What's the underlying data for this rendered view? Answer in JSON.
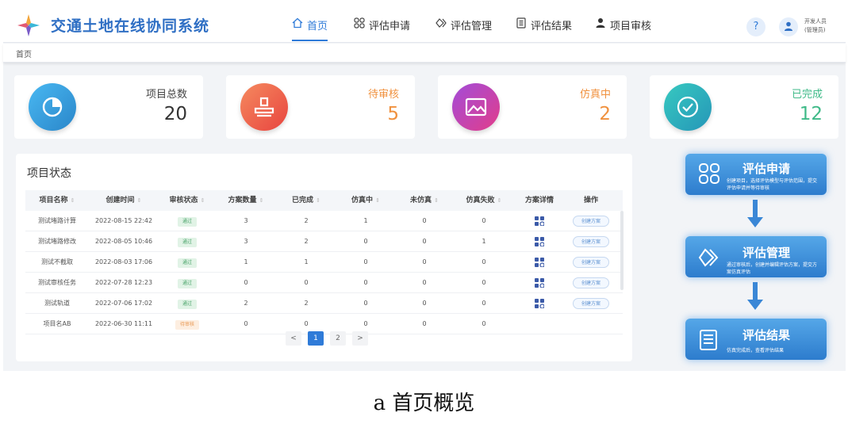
{
  "header": {
    "title": "交通土地在线协同系统",
    "nav": [
      {
        "label": "首页",
        "icon": "home-icon"
      },
      {
        "label": "评估申请",
        "icon": "grid-icon"
      },
      {
        "label": "评估管理",
        "icon": "diamond-icon"
      },
      {
        "label": "评估结果",
        "icon": "document-icon"
      },
      {
        "label": "项目审核",
        "icon": "user-icon"
      }
    ],
    "help_icon": "?",
    "user_name": "开发人员",
    "user_role": "(管理员)"
  },
  "breadcrumb": "首页",
  "stats": [
    {
      "label": "项目总数",
      "value": "20",
      "color": "#333333",
      "icon": "pie-chart-icon"
    },
    {
      "label": "待审核",
      "value": "5",
      "color": "#f0913e",
      "icon": "stamp-icon"
    },
    {
      "label": "仿真中",
      "value": "2",
      "color": "#f0913e",
      "icon": "image-icon"
    },
    {
      "label": "已完成",
      "value": "12",
      "color": "#3fba88",
      "icon": "check-circle-icon"
    }
  ],
  "status_panel": {
    "title": "项目状态",
    "columns": [
      "项目名称",
      "创建时间",
      "审核状态",
      "方案数量",
      "已完成",
      "仿真中",
      "未仿真",
      "仿真失败",
      "方案详情",
      "操作"
    ],
    "sort_icon": "⇕",
    "rows": [
      {
        "name": "测试堵路计算",
        "time": "2022-08-15 22:42",
        "status": "通过",
        "plans": "3",
        "done": "2",
        "running": "1",
        "notrun": "0",
        "failed": "0",
        "action": "创建方案"
      },
      {
        "name": "测试堵路修改",
        "time": "2022-08-05 10:46",
        "status": "通过",
        "plans": "3",
        "done": "2",
        "running": "0",
        "notrun": "0",
        "failed": "1",
        "action": "创建方案"
      },
      {
        "name": "测试不截取",
        "time": "2022-08-03 17:06",
        "status": "通过",
        "plans": "1",
        "done": "1",
        "running": "0",
        "notrun": "0",
        "failed": "0",
        "action": "创建方案"
      },
      {
        "name": "测试审核任务",
        "time": "2022-07-28 12:23",
        "status": "通过",
        "plans": "0",
        "done": "0",
        "running": "0",
        "notrun": "0",
        "failed": "0",
        "action": "创建方案"
      },
      {
        "name": "测试轨道",
        "time": "2022-07-06 17:02",
        "status": "通过",
        "plans": "2",
        "done": "2",
        "running": "0",
        "notrun": "0",
        "failed": "0",
        "action": "创建方案"
      },
      {
        "name": "项目名AB",
        "time": "2022-06-30 11:11",
        "status": "待审核",
        "plans": "0",
        "done": "0",
        "running": "0",
        "notrun": "0",
        "failed": "0",
        "action": ""
      }
    ],
    "pagination": {
      "prev": "<",
      "pages": [
        "1",
        "2"
      ],
      "current": "1",
      "next": ">"
    }
  },
  "flow": [
    {
      "title": "评估申请",
      "desc": "创建项目，选择评估模型与评估范围，提交评估申请并等待审核",
      "icon": "grid-icon"
    },
    {
      "title": "评估管理",
      "desc": "通过审核后，创建并编辑评估方案，提交方案仿真评估",
      "icon": "diamond-icon"
    },
    {
      "title": "评估结果",
      "desc": "仿真完成后，查看评估结果",
      "icon": "document-icon"
    }
  ],
  "caption": "a 首页概览",
  "colors": {
    "accent": "#2f7bd8",
    "orange": "#f0913e",
    "green": "#3fba88"
  }
}
